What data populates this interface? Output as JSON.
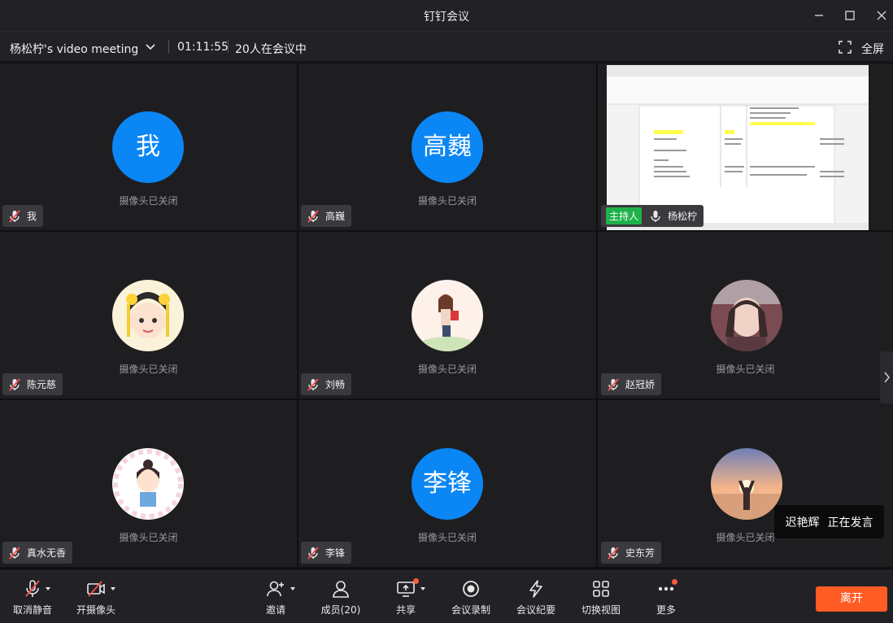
{
  "window": {
    "title": "钉钉会议"
  },
  "meeting": {
    "name": "杨松柠's video meeting",
    "timer": "01:11:55",
    "participants": "20人在会议中",
    "fullscreen": "全屏"
  },
  "tiles": [
    {
      "name": "我",
      "avatar_text": "我",
      "status": "摄像头已关闭",
      "mic": "muted-mic-icon"
    },
    {
      "name": "高巍",
      "avatar_text": "高巍",
      "status": "摄像头已关闭",
      "mic": "muted-mic-icon"
    },
    {
      "name": "杨松柠",
      "host": "主持人",
      "mic": "mic-icon",
      "screen_share": true
    },
    {
      "name": "陈元慈",
      "status": "摄像头已关闭",
      "mic": "muted-mic-icon"
    },
    {
      "name": "刘畅",
      "status": "摄像头已关闭",
      "mic": "muted-mic-icon"
    },
    {
      "name": "赵冠娇",
      "status": "摄像头已关闭",
      "mic": "muted-mic-icon"
    },
    {
      "name": "真水无香",
      "status": "摄像头已关闭",
      "mic": "muted-mic-icon"
    },
    {
      "name": "李锋",
      "avatar_text": "李锋",
      "status": "摄像头已关闭",
      "mic": "muted-mic-icon"
    },
    {
      "name": "史东芳",
      "status": "摄像头已关闭",
      "mic": "muted-mic-icon"
    }
  ],
  "speaking": {
    "name": "迟艳辉",
    "label": "正在发言"
  },
  "toolbar": {
    "unmute": "取消静音",
    "camera": "开摄像头",
    "invite": "邀请",
    "members": "成员(20)",
    "share": "共享",
    "record": "会议录制",
    "minutes": "会议纪要",
    "view": "切换视图",
    "more": "更多",
    "leave": "离开"
  },
  "colors": {
    "avatar_blue": "#0a86f5",
    "host_green": "#1fb24a",
    "leave_orange": "#ff5b24",
    "muted_red": "#ff4d4f"
  }
}
